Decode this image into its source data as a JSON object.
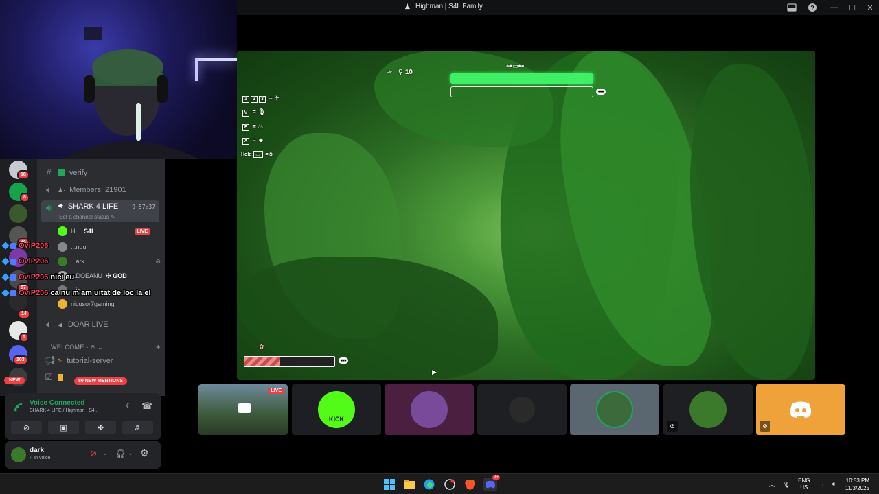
{
  "window": {
    "title": "Highman | S4L Family"
  },
  "sidebar": {
    "servers": [
      {
        "badge": "18",
        "color": "#c9c9d1"
      },
      {
        "badge": "8",
        "color": "#16a34a"
      },
      {
        "badge": "",
        "color": "#3a5a2e"
      },
      {
        "badge": "46",
        "color": "#555"
      },
      {
        "badge": "",
        "color": "#7a3aa8"
      },
      {
        "badge": "57",
        "color": "#4a4a4a"
      },
      {
        "badge": "14",
        "color": "#2a2a2a"
      },
      {
        "badge": "1",
        "color": "#e8e8e8"
      },
      {
        "badge": "103",
        "color": "#5865f2"
      }
    ],
    "new_label": "NEW",
    "channels": {
      "verify": "verify",
      "members": "Members: 21901",
      "shark": "SHARK 4 LIFE",
      "shark_timer": "9:57:37",
      "shark_status": "Set a channel status",
      "doar_live": "DOAR LIVE",
      "category_welcome": "WELCOME -",
      "tutorial": "tutorial-server"
    },
    "voice_users": [
      {
        "name": "H...",
        "tag": "S4L",
        "live": "LIVE"
      },
      {
        "name": "...ndu"
      },
      {
        "name": "...ark"
      },
      {
        "name": "...DOEANU",
        "tag": "GOD"
      },
      {
        "name": "...ig"
      },
      {
        "name": "nicusor7gaming"
      }
    ],
    "mentions_label": "80 NEW MENTIONS"
  },
  "chat": [
    {
      "nick": "OviP206",
      "msg": ""
    },
    {
      "nick": "OviP206",
      "msg": ""
    },
    {
      "nick": "OviP206",
      "msg": "nici eu"
    },
    {
      "nick": "OviP206",
      "msg": "ca nu m am uitat de loc la el"
    }
  ],
  "voice_panel": {
    "title": "Voice Connected",
    "subtitle": "SHARK 4 LIFE / Highman | S4..."
  },
  "user_panel": {
    "name": "dark",
    "status": "In voice"
  },
  "game_hud": {
    "ammo": "10",
    "hold_label": "Hold",
    "keys": [
      "1",
      "2",
      "3",
      "V",
      "F",
      "X"
    ],
    "health_fraction": 1.0,
    "stamina_fraction": 0.0,
    "hunger_fraction": 0.4
  },
  "tiles": [
    {
      "live": "LIVE",
      "bg": "#2f3a2a"
    },
    {
      "label": "KICK",
      "bg": "#1e1f22",
      "circle": "#53fc18"
    },
    {
      "bg": "#4a1f3f",
      "circle": "#7a4a9a"
    },
    {
      "bg": "#1e1f22",
      "circle": "#2a2a2a"
    },
    {
      "bg": "#5a6670",
      "circle": "#3c6a3a"
    },
    {
      "bg": "#1e1f22",
      "circle": "#3a7a2a"
    },
    {
      "bg": "#f0a23a"
    }
  ],
  "taskbar": {
    "lang": "ENG",
    "region": "US",
    "time": "10:53 PM",
    "date": "11/3/2025",
    "discord_badge": "9+"
  },
  "colors": {
    "accent_green": "#23a55a",
    "danger": "#f23f43",
    "blurple": "#5865f2"
  }
}
